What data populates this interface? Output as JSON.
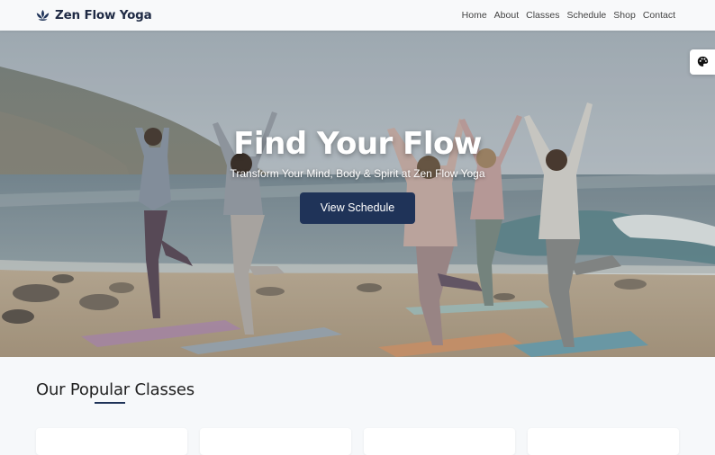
{
  "brand": {
    "name": "Zen Flow Yoga",
    "icon": "lotus-icon"
  },
  "nav": {
    "links": [
      "Home",
      "About",
      "Classes",
      "Schedule",
      "Shop",
      "Contact"
    ]
  },
  "hero": {
    "title": "Find Your Flow",
    "subtitle": "Transform Your Mind, Body & Spirit at Zen Flow Yoga",
    "button_label": "View Schedule"
  },
  "theme_toggle": {
    "icon": "palette-icon"
  },
  "popular": {
    "title": "Our Popular Classes"
  },
  "colors": {
    "primary": "#1f3358",
    "navbar_bg": "#f8f9fa",
    "page_bg": "#f6f8fa"
  }
}
